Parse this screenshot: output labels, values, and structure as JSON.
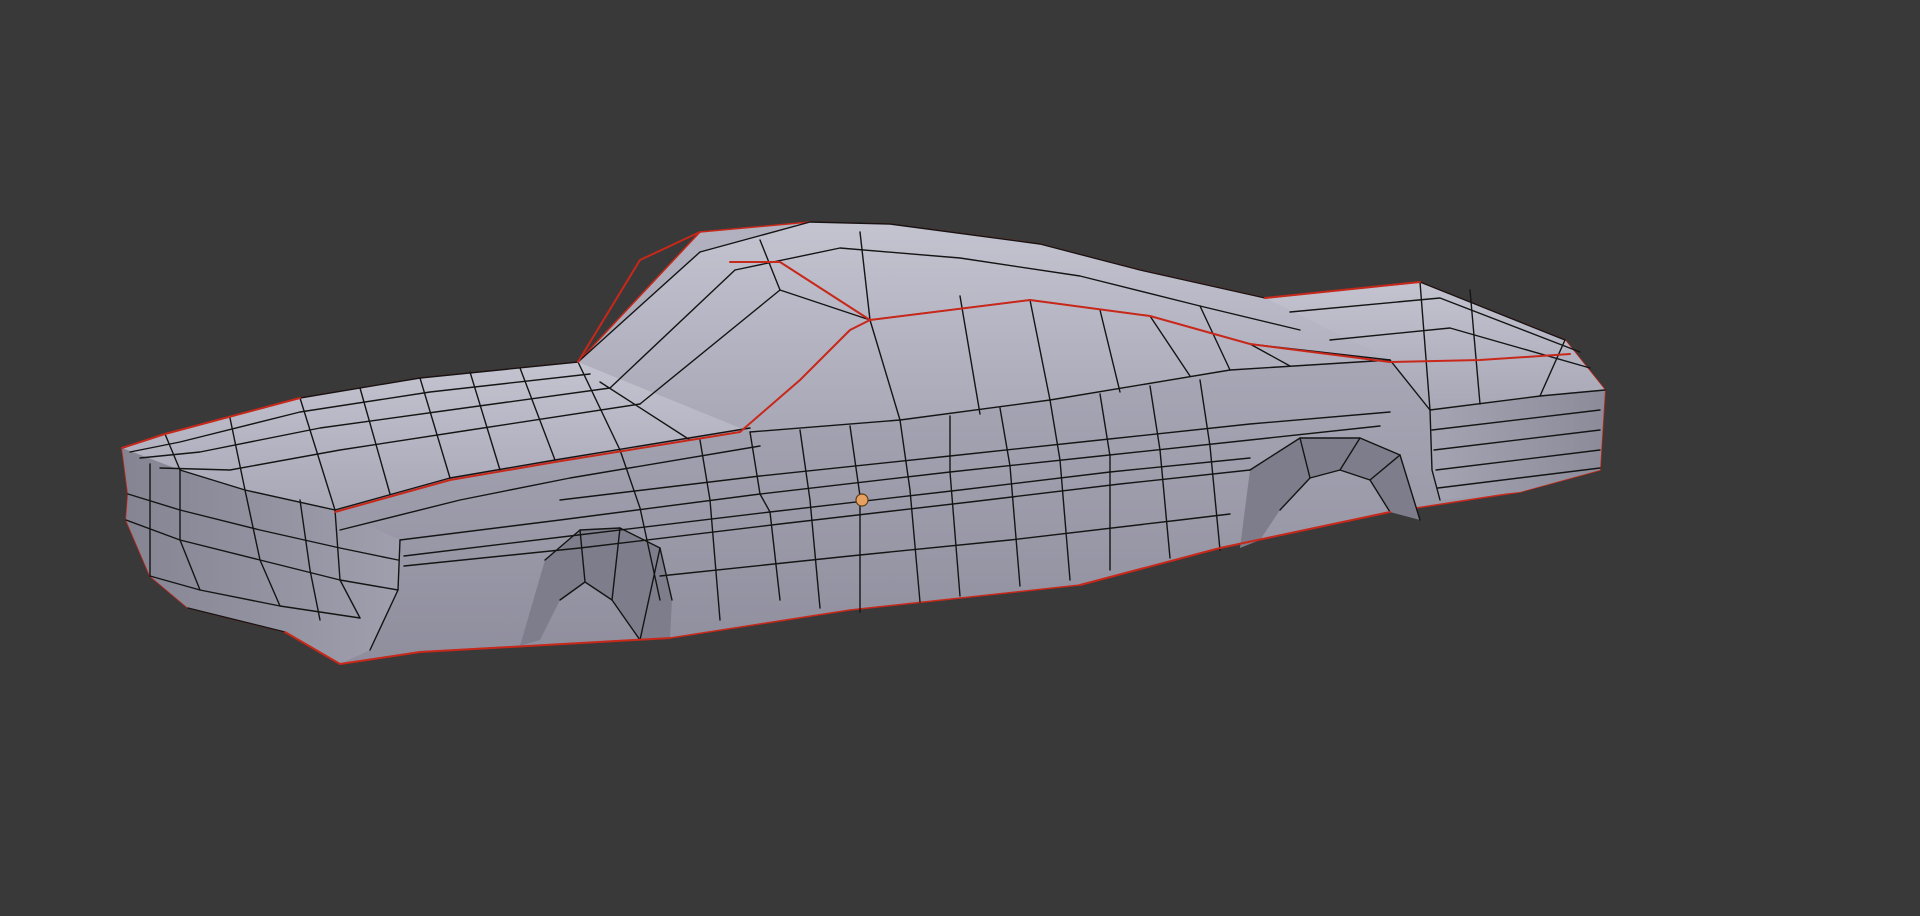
{
  "viewport": {
    "background_color": "#393939",
    "mesh_face_color": "#a9a8b6",
    "mesh_edge_color": "#141414",
    "seam_edge_color": "#c8281a",
    "origin_point_color": "#e8a060",
    "object": "car-body-low-poly-mesh",
    "shading": "solid",
    "display": "wireframe-over-solid"
  }
}
